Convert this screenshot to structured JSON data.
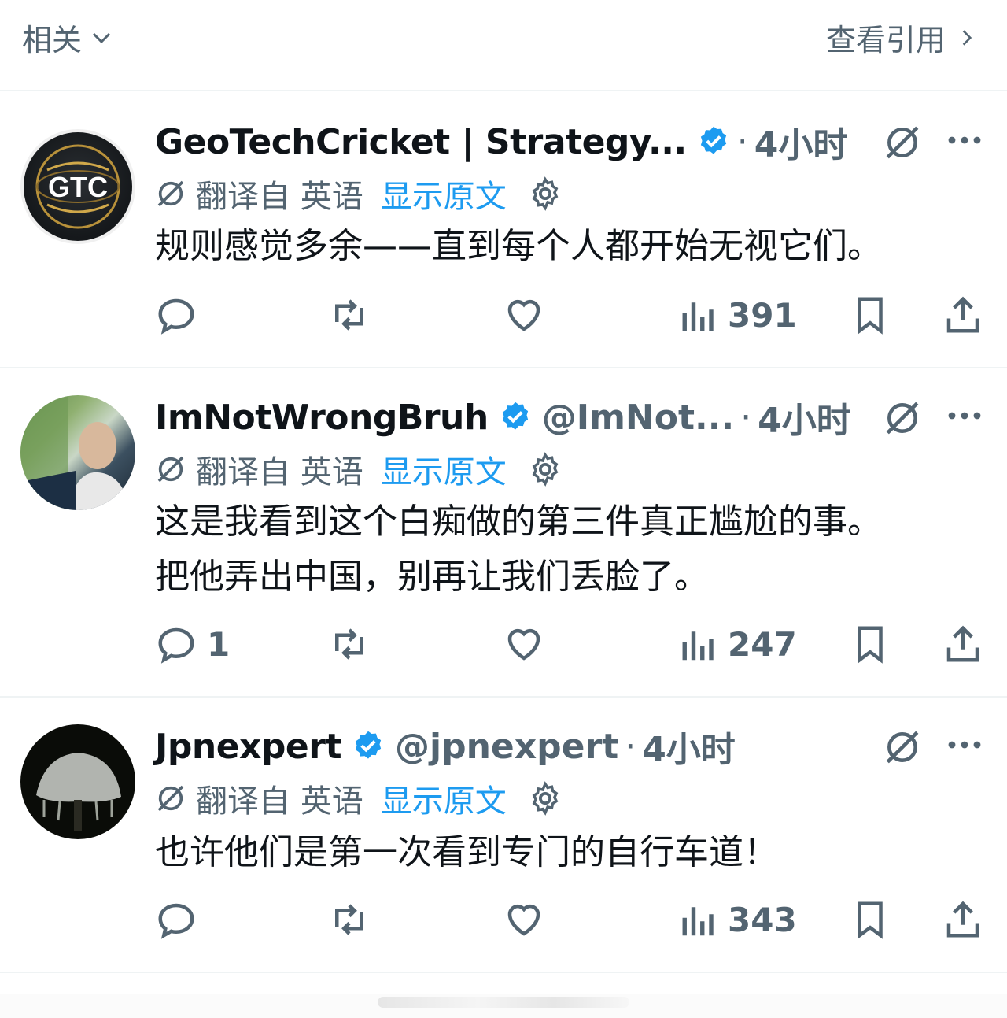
{
  "header": {
    "sort_label": "相关",
    "quotes_label": "查看引用"
  },
  "tweets": [
    {
      "name": "GeoTechCricket | Strategy...",
      "handle": "",
      "time": "4小时",
      "avatar_text": "GTC",
      "translated_from": "翻译自 英语",
      "show_original": "显示原文",
      "lines": [
        "规则感觉多余——直到每个人都开始无视它们。"
      ],
      "replies": "",
      "views": "391"
    },
    {
      "name": "ImNotWrongBruh",
      "handle": "@ImNot...",
      "time": "4小时",
      "translated_from": "翻译自 英语",
      "show_original": "显示原文",
      "lines": [
        "这是我看到这个白痴做的第三件真正尴尬的事。",
        "把他弄出中国，别再让我们丢脸了。"
      ],
      "replies": "1",
      "views": "247"
    },
    {
      "name": "Jpnexpert",
      "handle": "@jpnexpert",
      "time": "4小时",
      "translated_from": "翻译自 英语",
      "show_original": "显示原文",
      "lines": [
        "也许他们是第一次看到专门的自行车道！"
      ],
      "replies": "",
      "views": "343"
    }
  ],
  "colors": {
    "accent": "#1d9bf0",
    "secondary_text": "#536471",
    "primary_text": "#0f1419"
  }
}
